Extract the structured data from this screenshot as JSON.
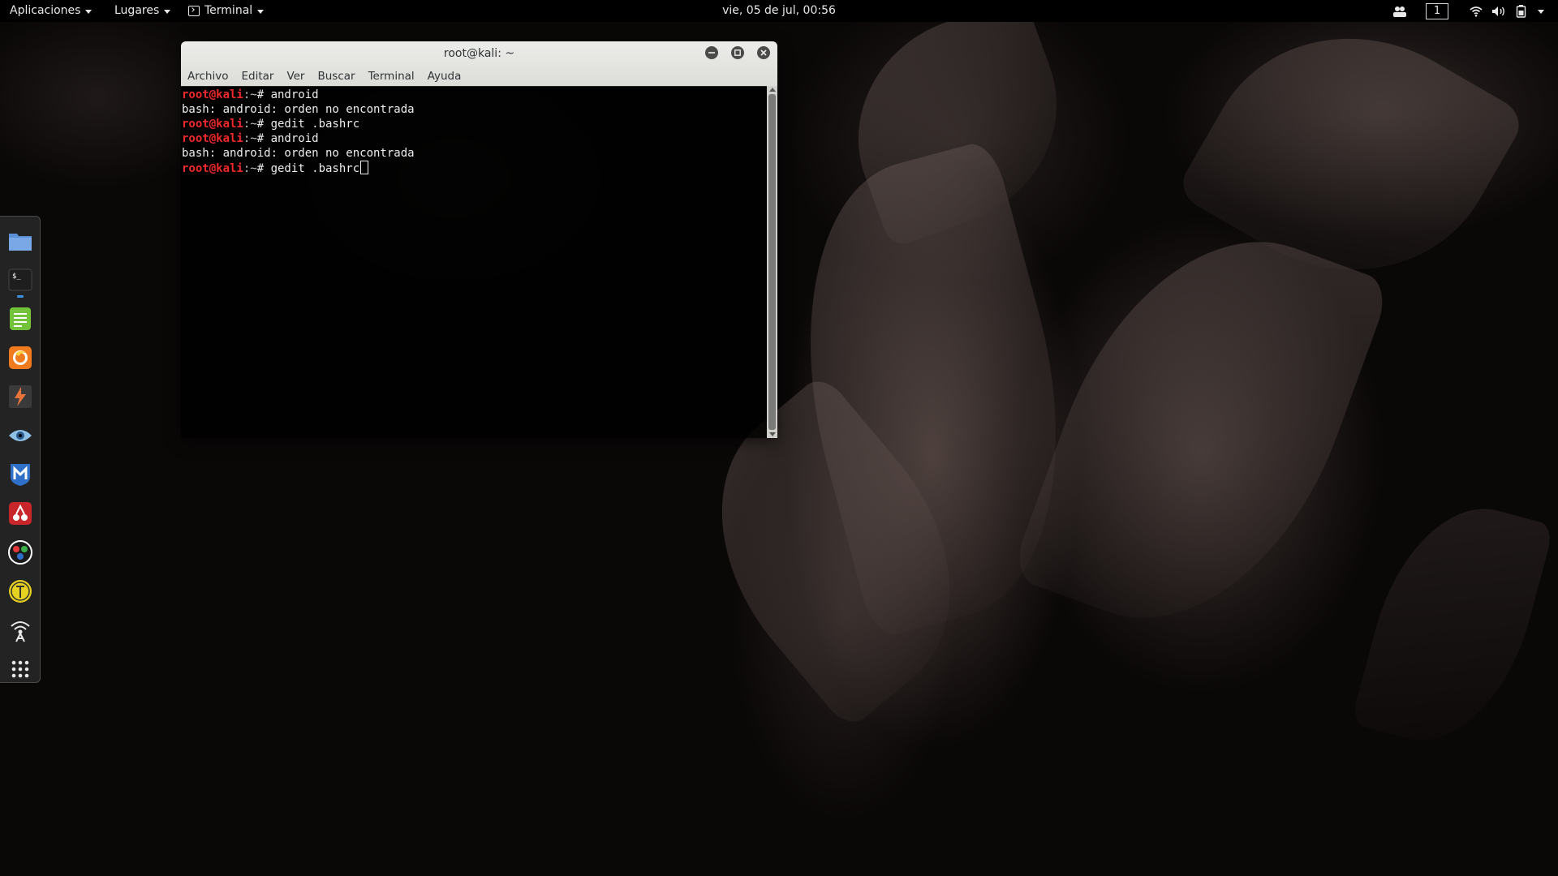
{
  "topbar": {
    "applications": "Aplicaciones",
    "places": "Lugares",
    "active_app": "Terminal",
    "clock": "vie, 05 de jul, 00:56",
    "workspace": "1",
    "icons": [
      "people-icon",
      "wifi-icon",
      "volume-icon",
      "battery-icon",
      "chevron-down-icon"
    ]
  },
  "terminal": {
    "title": "root@kali: ~",
    "menu": [
      "Archivo",
      "Editar",
      "Ver",
      "Buscar",
      "Terminal",
      "Ayuda"
    ],
    "prompt_user": "root@kali",
    "prompt_path": ":~",
    "prompt_symbol": "# ",
    "lines": [
      {
        "type": "cmd",
        "text": "android"
      },
      {
        "type": "out",
        "text": "bash: android: orden no encontrada"
      },
      {
        "type": "cmd",
        "text": "gedit .bashrc"
      },
      {
        "type": "cmd",
        "text": "android"
      },
      {
        "type": "out",
        "text": "bash: android: orden no encontrada"
      },
      {
        "type": "cmd",
        "text": "gedit .bashrc",
        "cursor": true
      }
    ]
  },
  "dock": {
    "items": [
      {
        "name": "files-icon",
        "color": "#5b8fd6"
      },
      {
        "name": "terminal-icon",
        "color": "#1e1e1e",
        "running": true
      },
      {
        "name": "text-editor-icon",
        "color": "#73c33a"
      },
      {
        "name": "firefox-icon",
        "color": "#f07a1e"
      },
      {
        "name": "burpsuite-icon",
        "color": "#e8743b"
      },
      {
        "name": "eye-icon",
        "color": "#8fc0e6"
      },
      {
        "name": "metasploit-icon",
        "color": "#2f6fc7"
      },
      {
        "name": "cherrytree-icon",
        "color": "#c8262b"
      },
      {
        "name": "maltego-icon",
        "color": "#ffffff"
      },
      {
        "name": "sqlmap-icon",
        "color": "#e6d020"
      },
      {
        "name": "wifi-tool-icon",
        "color": "#e8e8e8"
      },
      {
        "name": "app-grid-icon",
        "color": "#e8e8e8"
      }
    ]
  }
}
